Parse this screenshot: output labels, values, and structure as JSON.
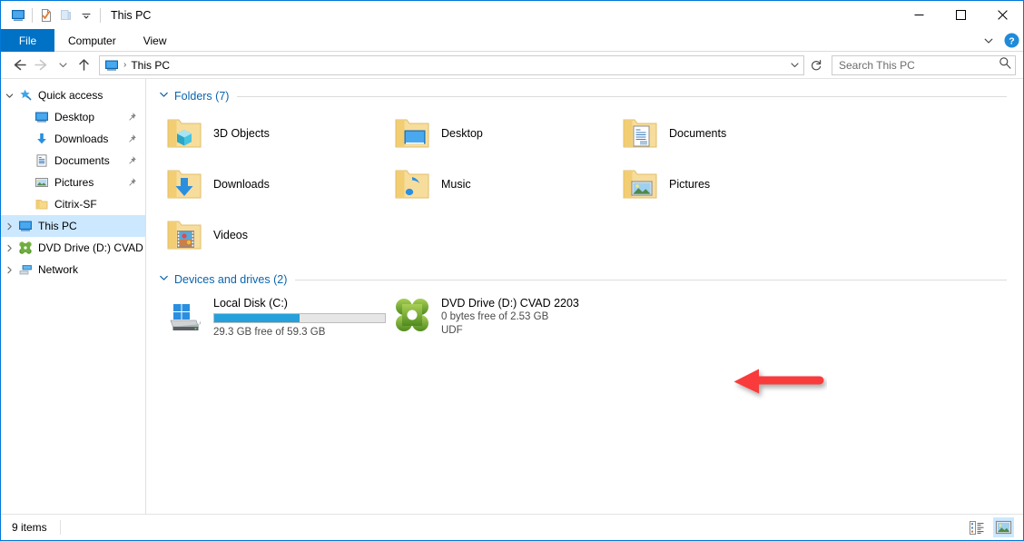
{
  "window": {
    "title": "This PC",
    "quick_access_toolbar": [
      {
        "name": "this-pc-icon",
        "label": "This PC"
      },
      {
        "name": "properties-icon",
        "label": "Properties"
      },
      {
        "name": "new-folder-icon",
        "label": "New folder"
      },
      {
        "name": "customize-chevron-icon",
        "label": "Customize Quick Access Toolbar"
      }
    ],
    "controls": {
      "minimize": "─",
      "maximize": "□",
      "close": "✕"
    }
  },
  "ribbon": {
    "tabs": [
      {
        "label": "File",
        "active": true
      },
      {
        "label": "Computer",
        "active": false
      },
      {
        "label": "View",
        "active": false
      }
    ],
    "expand_label": "Expand the Ribbon",
    "help_label": "?"
  },
  "address": {
    "back_label": "Back",
    "forward_label": "Forward",
    "recent_label": "Recent locations",
    "up_label": "Up",
    "breadcrumb": [
      "This PC"
    ],
    "separator": "›",
    "dropdown": "⌄",
    "refresh_label": "Refresh"
  },
  "search": {
    "placeholder": "Search This PC",
    "value": ""
  },
  "sidebar": {
    "items": [
      {
        "label": "Quick access",
        "icon": "star-pin-icon",
        "twisty": "expanded",
        "indent": 0,
        "pinned": false,
        "selected": false
      },
      {
        "label": "Desktop",
        "icon": "desktop-icon",
        "twisty": "none",
        "indent": 1,
        "pinned": true,
        "selected": false
      },
      {
        "label": "Downloads",
        "icon": "downloads-icon",
        "twisty": "none",
        "indent": 1,
        "pinned": true,
        "selected": false
      },
      {
        "label": "Documents",
        "icon": "documents-icon",
        "twisty": "none",
        "indent": 1,
        "pinned": true,
        "selected": false
      },
      {
        "label": "Pictures",
        "icon": "pictures-icon",
        "twisty": "none",
        "indent": 1,
        "pinned": true,
        "selected": false
      },
      {
        "label": "Citrix-SF",
        "icon": "folder-icon",
        "twisty": "none",
        "indent": 1,
        "pinned": false,
        "selected": false
      },
      {
        "label": "This PC",
        "icon": "this-pc-icon",
        "twisty": "collapsed",
        "indent": 0,
        "pinned": false,
        "selected": true
      },
      {
        "label": "DVD Drive (D:) CVAD",
        "icon": "dvd-drive-icon",
        "twisty": "collapsed",
        "indent": 0,
        "pinned": false,
        "selected": false
      },
      {
        "label": "Network",
        "icon": "network-icon",
        "twisty": "collapsed",
        "indent": 0,
        "pinned": false,
        "selected": false
      }
    ]
  },
  "content": {
    "groups": [
      {
        "title": "Folders (7)",
        "chevron": "⌄",
        "items": [
          {
            "label": "3D Objects",
            "icon": "folder-3d-objects-icon"
          },
          {
            "label": "Desktop",
            "icon": "folder-desktop-icon"
          },
          {
            "label": "Documents",
            "icon": "folder-documents-icon"
          },
          {
            "label": "Downloads",
            "icon": "folder-downloads-icon"
          },
          {
            "label": "Music",
            "icon": "folder-music-icon"
          },
          {
            "label": "Pictures",
            "icon": "folder-pictures-icon"
          },
          {
            "label": "Videos",
            "icon": "folder-videos-icon"
          }
        ]
      },
      {
        "title": "Devices and drives (2)",
        "chevron": "⌄",
        "drives": [
          {
            "name": "Local Disk (C:)",
            "icon": "local-disk-icon",
            "capacity_text": "29.3 GB free of 59.3 GB",
            "used_percent": 50,
            "filesystem": "",
            "has_bar": true
          },
          {
            "name": "DVD Drive (D:) CVAD 2203",
            "icon": "dvd-drive-icon",
            "capacity_text": "0 bytes free of 2.53 GB",
            "used_percent": 100,
            "filesystem": "UDF",
            "has_bar": false
          }
        ]
      }
    ],
    "annotation": {
      "name": "red-arrow-annotation",
      "color": "#f93a3a",
      "direction": "left"
    }
  },
  "status": {
    "items_text": "9 items",
    "view_details_label": "Details view",
    "view_large_icons_label": "Large icons view"
  },
  "colors": {
    "accent": "#0078d7",
    "file_tab": "#0072c6",
    "group_header": "#0a64ad",
    "selection": "#cce8ff",
    "capacity_bar": "#26a0da",
    "annotation_red": "#f93a3a"
  }
}
